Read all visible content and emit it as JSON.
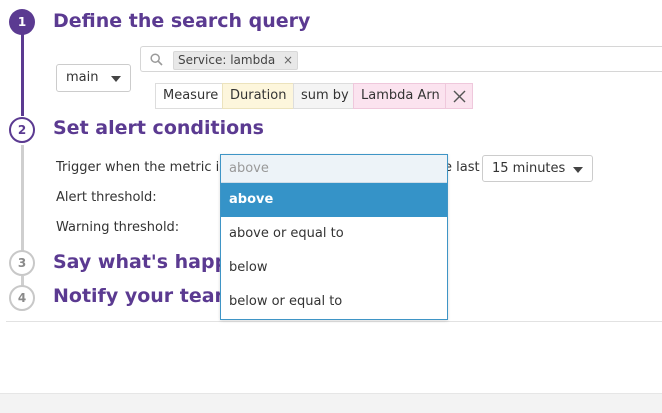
{
  "steps": [
    {
      "number": "1",
      "title": "Define the search query"
    },
    {
      "number": "2",
      "title": "Set alert conditions"
    },
    {
      "number": "3",
      "title": "Say what's happening"
    },
    {
      "number": "4",
      "title": "Notify your team"
    }
  ],
  "query": {
    "source_select": "main",
    "filter_tag": "Service: lambda",
    "filter_tag_remove": "×",
    "measure_label": "Measure",
    "measure_value": "Duration",
    "sum_by_label": "sum by",
    "sum_by_value": "Lambda Arn",
    "remove_symbol": "✕"
  },
  "conditions": {
    "trigger_label": "Trigger when the metric is",
    "trigger_suffix": "e last",
    "timeframe_select": "15 minutes",
    "alert_threshold_label": "Alert threshold:",
    "warning_threshold_label": "Warning threshold:"
  },
  "dropdown": {
    "input_value": "above",
    "options": [
      "above",
      "above or equal to",
      "below",
      "below or equal to"
    ],
    "selected": "above"
  },
  "colors": {
    "brand_purple": "#5b3a91",
    "selected_blue": "#3593c8",
    "duration_bg": "#fdf6dc",
    "lambda_bg": "#fbe3ef"
  },
  "icons": {
    "search": "search-icon",
    "close": "close-icon",
    "caret": "chevron-down-icon"
  }
}
